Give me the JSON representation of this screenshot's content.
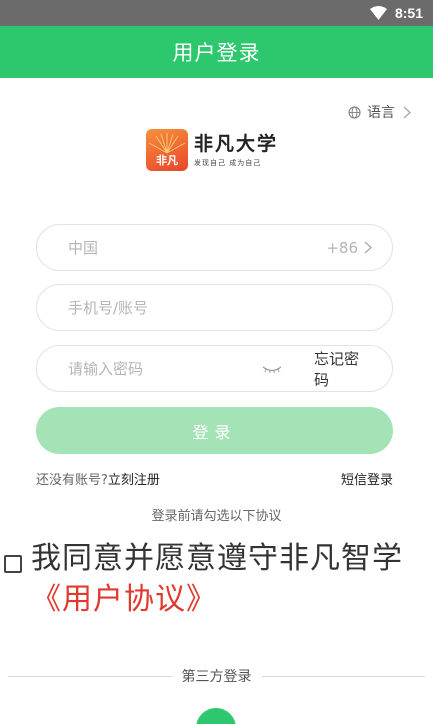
{
  "status_bar": {
    "time": "8:51",
    "icons": [
      "wifi-icon"
    ]
  },
  "header": {
    "title": "用户登录"
  },
  "language": {
    "label": "语言",
    "icon": "globe-icon"
  },
  "logo": {
    "mark_text": "非凡",
    "name": "非凡大学",
    "slogan": "发现自己 成为自己"
  },
  "form": {
    "country": {
      "value": "中国",
      "code": "+86"
    },
    "account": {
      "placeholder": "手机号/账号"
    },
    "password": {
      "placeholder": "请输入密码",
      "forgot_label": "忘记密码"
    },
    "login_label": "登录"
  },
  "links": {
    "no_account": "还没有账号?",
    "register": "立刻注册",
    "sms_login": "短信登录"
  },
  "agreement": {
    "hint": "登录前请勾选以下协议",
    "text": "我同意并愿意遵守非凡智学",
    "link": "《用户协议》"
  },
  "third_party": {
    "label": "第三方登录",
    "icon": "wechat-icon"
  },
  "colors": {
    "brand_green": "#2dc76d",
    "button_disabled": "#a4e3b6",
    "link_red": "#e0392f"
  }
}
